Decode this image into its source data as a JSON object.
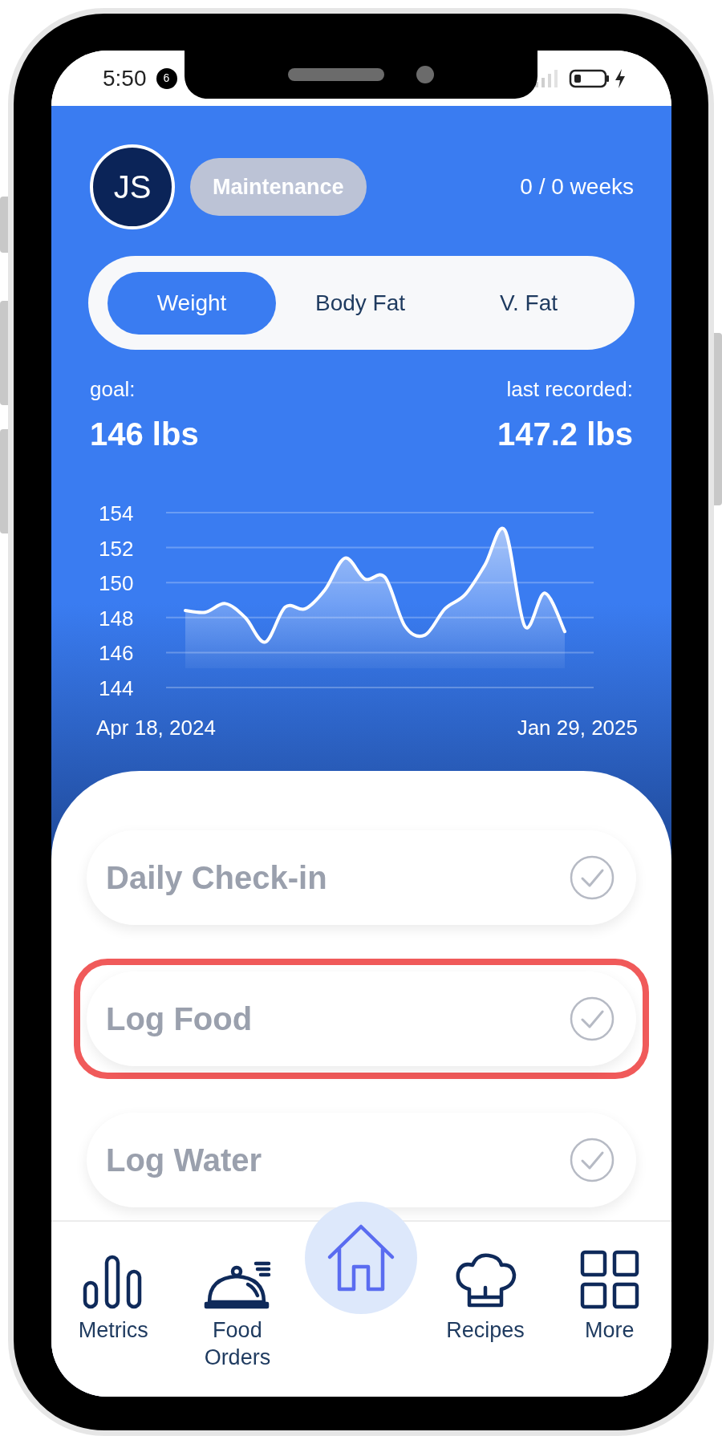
{
  "status_bar": {
    "time": "5:50",
    "notification_count": "6"
  },
  "header": {
    "avatar_initials": "JS",
    "phase_badge": "Maintenance",
    "weeks": "0 / 0 weeks"
  },
  "tabs": [
    {
      "label": "Weight",
      "selected": true
    },
    {
      "label": "Body Fat",
      "selected": false
    },
    {
      "label": "V. Fat",
      "selected": false
    }
  ],
  "goal": {
    "label": "goal:",
    "value": "146 lbs"
  },
  "last_recorded": {
    "label": "last recorded:",
    "value": "147.2 lbs"
  },
  "chart": {
    "start_date": "Apr 18, 2024",
    "end_date": "Jan 29, 2025",
    "chart_data": {
      "type": "area",
      "grid": true,
      "yticks": [
        144,
        146,
        148,
        150,
        152,
        154
      ],
      "ylim": [
        144,
        154
      ],
      "values": [
        148.4,
        148.3,
        148.8,
        148.0,
        146.6,
        148.6,
        148.5,
        149.6,
        151.4,
        150.2,
        150.3,
        147.5,
        147.0,
        148.5,
        149.3,
        151.0,
        153.0,
        147.5,
        149.4,
        147.2
      ]
    }
  },
  "tasks": [
    {
      "label": "Daily Check-in",
      "checked": false,
      "highlighted": false
    },
    {
      "label": "Log Food",
      "checked": false,
      "highlighted": true
    },
    {
      "label": "Log Water",
      "checked": false,
      "highlighted": false
    }
  ],
  "nav": [
    {
      "label": "Metrics",
      "selected": false
    },
    {
      "label": "Food Orders",
      "selected": false
    },
    {
      "selected": true
    },
    {
      "label": "Recipes",
      "selected": false
    },
    {
      "label": "More",
      "selected": false
    }
  ]
}
